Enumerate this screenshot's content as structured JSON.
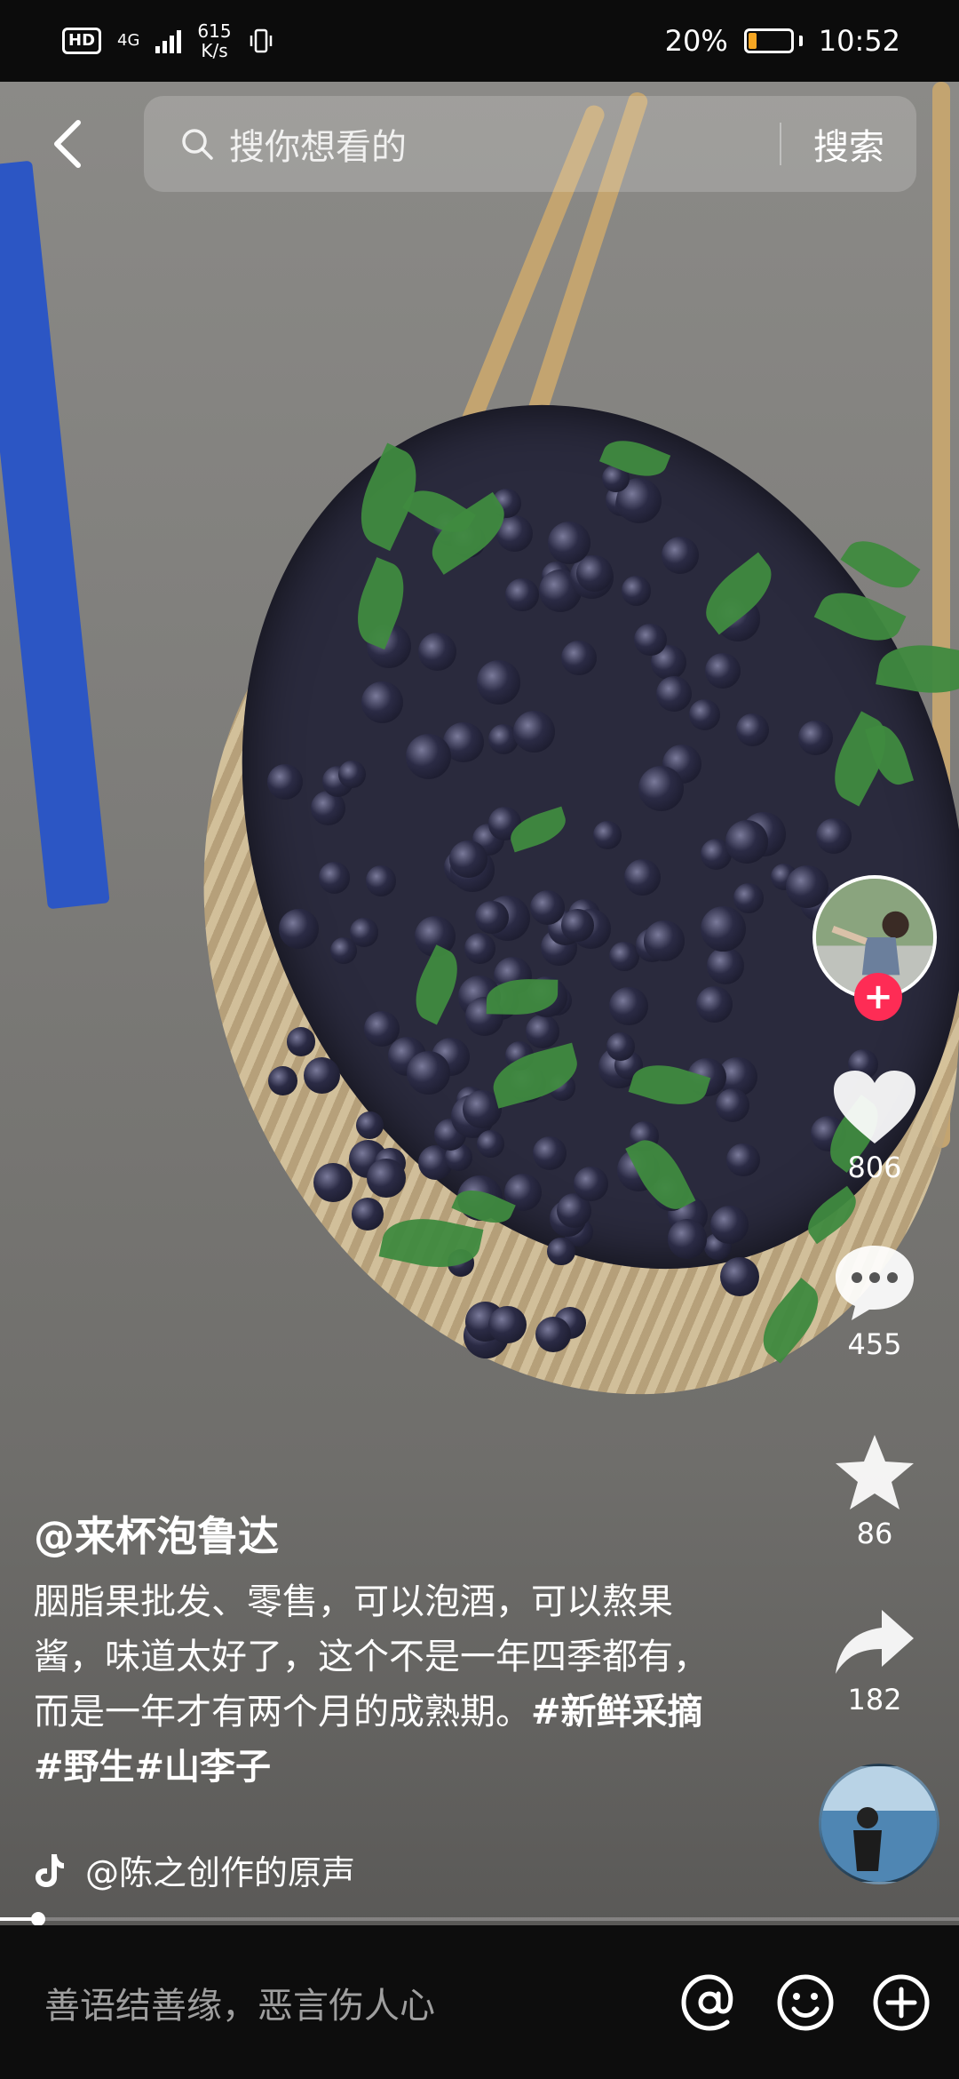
{
  "status_bar": {
    "hd": "HD",
    "network": "4G",
    "speed_value": "615",
    "speed_unit": "K/s",
    "battery_percent": "20%",
    "battery_level": 0.2,
    "time": "10:52"
  },
  "search": {
    "placeholder": "搜你想看的",
    "button": "搜索"
  },
  "actions": {
    "likes": "806",
    "comments": "455",
    "favorites": "86",
    "shares": "182"
  },
  "post": {
    "username": "@来杯泡鲁达",
    "caption_text": "胭脂果批发、零售，可以泡酒，可以熬果酱，味道太好了，这个不是一年四季都有，而是一年才有两个月的成熟期。",
    "hashtags": "#新鲜采摘 #野生#山李子",
    "sound": "@陈之创作的原声"
  },
  "playback": {
    "progress": 0.04
  },
  "comment_bar": {
    "placeholder": "善语结善缘，恶言伤人心"
  },
  "icons": [
    "back-arrow-icon",
    "search-icon",
    "heart-icon",
    "comment-icon",
    "star-icon",
    "share-icon",
    "at-icon",
    "emoji-icon",
    "plus-icon",
    "tiktok-note-icon"
  ],
  "colors": {
    "follow_red": "#fe2c55",
    "battery_fill": "#f5a623"
  }
}
